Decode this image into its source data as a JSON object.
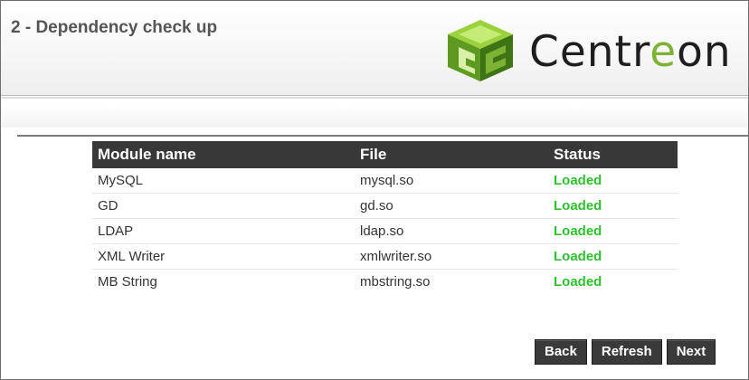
{
  "header": {
    "step_title": "2 - Dependency check up",
    "logo": {
      "text_prefix": "Centr",
      "text_accent": "e",
      "text_suffix": "on",
      "accent_color": "#7cb335",
      "icon": "centreon-cube-icon"
    }
  },
  "modules_table": {
    "columns": [
      "Module name",
      "File",
      "Status"
    ],
    "rows": [
      {
        "module": "MySQL",
        "file": "mysql.so",
        "status": "Loaded"
      },
      {
        "module": "GD",
        "file": "gd.so",
        "status": "Loaded"
      },
      {
        "module": "LDAP",
        "file": "ldap.so",
        "status": "Loaded"
      },
      {
        "module": "XML Writer",
        "file": "xmlwriter.so",
        "status": "Loaded"
      },
      {
        "module": "MB String",
        "file": "mbstring.so",
        "status": "Loaded"
      }
    ],
    "status_color": "#2fbf2f",
    "header_bg": "#383838"
  },
  "actions": {
    "back_label": "Back",
    "refresh_label": "Refresh",
    "next_label": "Next"
  }
}
